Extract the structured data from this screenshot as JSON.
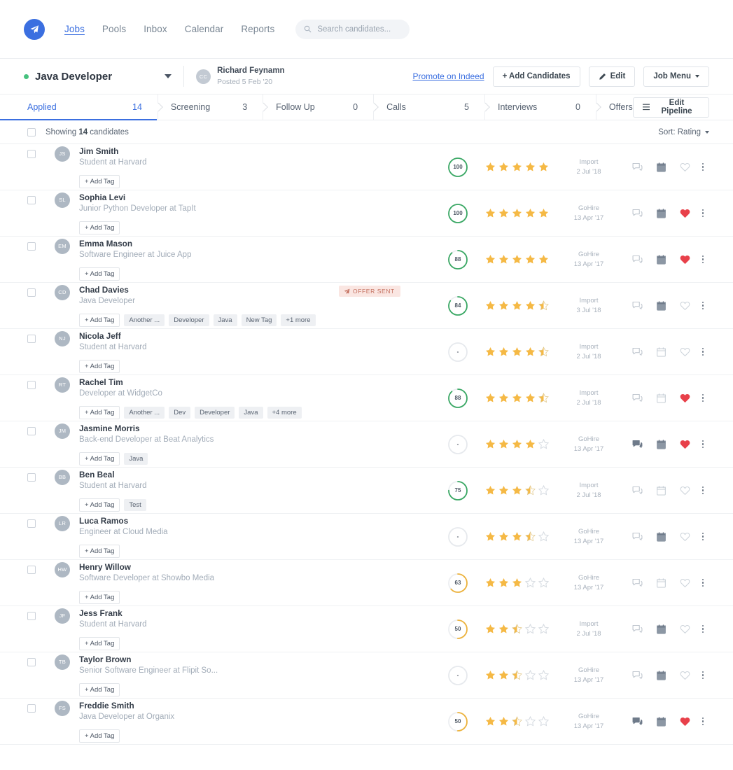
{
  "nav": {
    "logo_icon": "paper-plane-logo-icon",
    "links": [
      {
        "label": "Jobs",
        "active": true
      },
      {
        "label": "Pools",
        "active": false
      },
      {
        "label": "Inbox",
        "active": false
      },
      {
        "label": "Calendar",
        "active": false
      },
      {
        "label": "Reports",
        "active": false
      }
    ],
    "search_placeholder": "Search candidates...",
    "search_value": "",
    "search_icon": "search-icon"
  },
  "job_header": {
    "status_color": "#46c17e",
    "title": "Java Developer",
    "dropdown_icon": "chevron-down-icon",
    "poster_initials": "CC",
    "poster_name": "Richard Feynamn",
    "poster_posted": "Posted 5 Feb '20",
    "promote_label": "Promote on Indeed",
    "add_candidates_label": "+ Add Candidates",
    "edit_label": "Edit",
    "edit_icon": "pencil-icon",
    "job_menu_label": "Job Menu",
    "job_menu_icon": "caret-down-icon"
  },
  "pipeline": {
    "stages": [
      {
        "label": "Applied",
        "count": "14",
        "active": true
      },
      {
        "label": "Screening",
        "count": "3",
        "active": false
      },
      {
        "label": "Follow Up",
        "count": "0",
        "active": false
      },
      {
        "label": "Calls",
        "count": "5",
        "active": false
      },
      {
        "label": "Interviews",
        "count": "0",
        "active": false
      },
      {
        "label": "Offers",
        "count": "",
        "active": false
      }
    ],
    "edit_pipeline_label": "Edit Pipeline",
    "edit_pipeline_icon": "list-lines-icon"
  },
  "list_toolbar": {
    "select_all_name": "select-all-checkbox",
    "showing_prefix": "Showing ",
    "showing_count": "14",
    "showing_suffix": " candidates",
    "sort_label": "Sort: Rating",
    "sort_icon": "chevron-down-icon"
  },
  "candidates": [
    {
      "initials": "JS",
      "name": "Jim Smith",
      "role": "Student at Harvard",
      "add_tag": "+ Add Tag",
      "tags": [],
      "score": "100",
      "score_color": "#3aa864",
      "stars": 5,
      "source": "Import",
      "date": "2 Jul '18",
      "chat_state": "outline",
      "calendar_state": "filled",
      "heart_state": "outline",
      "offer_sent": false
    },
    {
      "initials": "SL",
      "name": "Sophia Levi",
      "role": "Junior Python Developer at TapIt",
      "add_tag": "+ Add Tag",
      "tags": [],
      "score": "100",
      "score_color": "#3aa864",
      "stars": 5,
      "source": "GoHire",
      "date": "13 Apr '17",
      "chat_state": "outline",
      "calendar_state": "filled",
      "heart_state": "filled",
      "offer_sent": false
    },
    {
      "initials": "EM",
      "name": "Emma Mason",
      "role": "Software Engineer at Juice App",
      "add_tag": "+ Add Tag",
      "tags": [],
      "score": "88",
      "score_color": "#3aa864",
      "stars": 5,
      "source": "GoHire",
      "date": "13 Apr '17",
      "chat_state": "outline",
      "calendar_state": "filled",
      "heart_state": "filled",
      "offer_sent": false
    },
    {
      "initials": "CD",
      "name": "Chad Davies",
      "role": "Java Developer",
      "add_tag": "+ Add Tag",
      "tags": [
        "Another ...",
        "Developer",
        "Java",
        "New Tag",
        "+1 more"
      ],
      "score": "84",
      "score_color": "#3aa864",
      "stars": 4.5,
      "source": "Import",
      "date": "3 Jul '18",
      "chat_state": "outline",
      "calendar_state": "filled",
      "heart_state": "outline",
      "offer_sent": true,
      "offer_label": "OFFER SENT",
      "offer_icon": "paper-plane-icon"
    },
    {
      "initials": "NJ",
      "name": "Nicola Jeff",
      "role": "Student at Harvard",
      "add_tag": "+ Add Tag",
      "tags": [],
      "score": "-",
      "score_color": "#e3e6ea",
      "stars": 4.5,
      "source": "Import",
      "date": "2 Jul '18",
      "chat_state": "outline",
      "calendar_state": "outline",
      "heart_state": "outline",
      "offer_sent": false
    },
    {
      "initials": "RT",
      "name": "Rachel Tim",
      "role": "Developer at WidgetCo",
      "add_tag": "+ Add Tag",
      "tags": [
        "Another ...",
        "Dev",
        "Developer",
        "Java",
        "+4 more"
      ],
      "score": "88",
      "score_color": "#3aa864",
      "stars": 4.5,
      "source": "Import",
      "date": "2 Jul '18",
      "chat_state": "outline",
      "calendar_state": "outline",
      "heart_state": "filled",
      "offer_sent": false
    },
    {
      "initials": "JM",
      "name": "Jasmine Morris",
      "role": "Back-end Developer at Beat Analytics",
      "add_tag": "+ Add Tag",
      "tags": [
        "Java"
      ],
      "score": "-",
      "score_color": "#e3e6ea",
      "stars": 4,
      "source": "GoHire",
      "date": "13 Apr '17",
      "chat_state": "filled",
      "calendar_state": "filled",
      "heart_state": "filled",
      "offer_sent": false
    },
    {
      "initials": "BB",
      "name": "Ben Beal",
      "role": "Student at Harvard",
      "add_tag": "+ Add Tag",
      "tags": [
        "Test"
      ],
      "score": "75",
      "score_color": "#3aa864",
      "stars": 3.5,
      "source": "Import",
      "date": "2 Jul '18",
      "chat_state": "outline",
      "calendar_state": "outline",
      "heart_state": "outline",
      "offer_sent": false
    },
    {
      "initials": "LR",
      "name": "Luca Ramos",
      "role": "Engineer at Cloud Media",
      "add_tag": "+ Add Tag",
      "tags": [],
      "score": "-",
      "score_color": "#e3e6ea",
      "stars": 3.5,
      "source": "GoHire",
      "date": "13 Apr '17",
      "chat_state": "outline",
      "calendar_state": "filled",
      "heart_state": "outline",
      "offer_sent": false
    },
    {
      "initials": "HW",
      "name": "Henry Willow",
      "role": "Software Developer at Showbo Media",
      "add_tag": "+ Add Tag",
      "tags": [],
      "score": "63",
      "score_color": "#edb33d",
      "stars": 3,
      "source": "GoHire",
      "date": "13 Apr '17",
      "chat_state": "outline",
      "calendar_state": "outline",
      "heart_state": "outline",
      "offer_sent": false
    },
    {
      "initials": "JF",
      "name": "Jess Frank",
      "role": "Student at Harvard",
      "add_tag": "+ Add Tag",
      "tags": [],
      "score": "50",
      "score_color": "#edb33d",
      "stars": 2.5,
      "source": "Import",
      "date": "2 Jul '18",
      "chat_state": "outline",
      "calendar_state": "filled",
      "heart_state": "outline",
      "offer_sent": false
    },
    {
      "initials": "TB",
      "name": "Taylor Brown",
      "role": "Senior Software Engineer at Flipit So...",
      "add_tag": "+ Add Tag",
      "tags": [],
      "score": "-",
      "score_color": "#e3e6ea",
      "stars": 2.5,
      "source": "GoHire",
      "date": "13 Apr '17",
      "chat_state": "outline",
      "calendar_state": "filled",
      "heart_state": "outline",
      "offer_sent": false
    },
    {
      "initials": "FS",
      "name": "Freddie Smith",
      "role": "Java Developer at Organix",
      "add_tag": "+ Add Tag",
      "tags": [],
      "score": "50",
      "score_color": "#edb33d",
      "stars": 2.5,
      "source": "GoHire",
      "date": "13 Apr '17",
      "chat_state": "filled",
      "calendar_state": "filled",
      "heart_state": "filled",
      "offer_sent": false
    }
  ],
  "colors": {
    "brand_blue": "#3b6fe0",
    "star_gold": "#f5b945",
    "score_green": "#3aa864",
    "score_amber": "#edb33d",
    "heart_red": "#e8404a",
    "offer_bg": "#fae6e2",
    "offer_fg": "#c4705f"
  }
}
